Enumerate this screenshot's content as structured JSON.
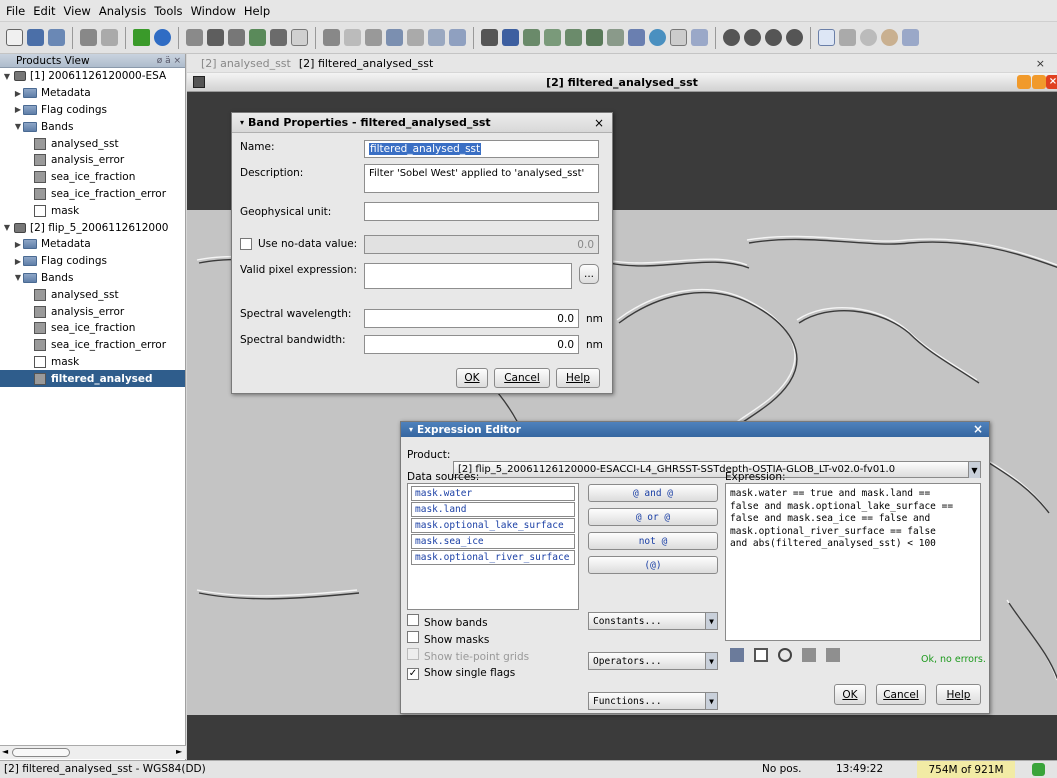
{
  "menu": [
    "File",
    "Edit",
    "View",
    "Analysis",
    "Tools",
    "Window",
    "Help"
  ],
  "products_view": {
    "title": "Products View",
    "controls": "ø ä ×"
  },
  "tree": [
    {
      "label": "[1] 20061126120000-ESA",
      "level": 0,
      "type": "product"
    },
    {
      "label": "Metadata",
      "level": 1,
      "type": "folder"
    },
    {
      "label": "Flag codings",
      "level": 1,
      "type": "folder"
    },
    {
      "label": "Bands",
      "level": 1,
      "type": "folder"
    },
    {
      "label": "analysed_sst",
      "level": 2,
      "type": "band"
    },
    {
      "label": "analysis_error",
      "level": 2,
      "type": "band"
    },
    {
      "label": "sea_ice_fraction",
      "level": 2,
      "type": "band"
    },
    {
      "label": "sea_ice_fraction_error",
      "level": 2,
      "type": "band"
    },
    {
      "label": "mask",
      "level": 2,
      "type": "band"
    },
    {
      "label": "[2] flip_5_2006112612000",
      "level": 0,
      "type": "product"
    },
    {
      "label": "Metadata",
      "level": 1,
      "type": "folder"
    },
    {
      "label": "Flag codings",
      "level": 1,
      "type": "folder"
    },
    {
      "label": "Bands",
      "level": 1,
      "type": "folder"
    },
    {
      "label": "analysed_sst",
      "level": 2,
      "type": "band"
    },
    {
      "label": "analysis_error",
      "level": 2,
      "type": "band"
    },
    {
      "label": "sea_ice_fraction",
      "level": 2,
      "type": "band"
    },
    {
      "label": "sea_ice_fraction_error",
      "level": 2,
      "type": "band"
    },
    {
      "label": "mask",
      "level": 2,
      "type": "band"
    },
    {
      "label": "filtered_analysed",
      "level": 2,
      "type": "band",
      "selected": true
    }
  ],
  "tabs": [
    "[2] analysed_sst",
    "[2] filtered_analysed_sst"
  ],
  "view_title": "[2] filtered_analysed_sst",
  "band_props": {
    "title": "Band Properties - filtered_analysed_sst",
    "name_label": "Name:",
    "name_value": "filtered_analysed_sst",
    "desc_label": "Description:",
    "desc_value": "Filter 'Sobel West' applied to 'analysed_sst'",
    "unit_label": "Geophysical unit:",
    "nodata_label": "Use no-data value:",
    "nodata_value": "0.0",
    "valid_label": "Valid pixel expression:",
    "valid_btn": "...",
    "wavelength_label": "Spectral wavelength:",
    "wavelength_value": "0.0",
    "wavelength_unit": "nm",
    "bandwidth_label": "Spectral bandwidth:",
    "bandwidth_value": "0.0",
    "bandwidth_unit": "nm",
    "ok": "OK",
    "cancel": "Cancel",
    "help": "Help"
  },
  "expr_editor": {
    "title": "Expression Editor",
    "product_label": "Product:",
    "product_value": "[2] flip_5_20061126120000-ESACCI-L4_GHRSST-SSTdepth-OSTIA-GLOB_LT-v02.0-fv01.0",
    "data_sources_label": "Data sources:",
    "data_sources": [
      "mask.water",
      "mask.land",
      "mask.optional_lake_surface",
      "mask.sea_ice",
      "mask.optional_river_surface"
    ],
    "ops": [
      "@ and @",
      "@ or @",
      "not @",
      "(@)"
    ],
    "dropdowns": [
      "Constants...",
      "Operators...",
      "Functions..."
    ],
    "expression_label": "Expression:",
    "expression": "mask.water == true and mask.land ==\nfalse and mask.optional_lake_surface ==\nfalse and mask.sea_ice == false and\nmask.optional_river_surface == false\nand abs(filtered_analysed_sst) < 100",
    "checks": [
      {
        "label": "Show bands",
        "checked": false,
        "enabled": true
      },
      {
        "label": "Show masks",
        "checked": false,
        "enabled": true
      },
      {
        "label": "Show tie-point grids",
        "checked": false,
        "enabled": false
      },
      {
        "label": "Show single flags",
        "checked": true,
        "enabled": true
      }
    ],
    "status": "Ok, no errors.",
    "ok": "OK",
    "cancel": "Cancel",
    "help": "Help"
  },
  "status": {
    "left": "[2] filtered_analysed_sst - WGS84(DD)",
    "pos": "No pos.",
    "time": "13:49:22",
    "memory": "754M of 921M"
  },
  "colors": {
    "selection": "#2f5d8c",
    "status_ok": "#1d9a1d",
    "title_blue": "#3c6ea8",
    "memory_bg": "#f2eba5"
  }
}
